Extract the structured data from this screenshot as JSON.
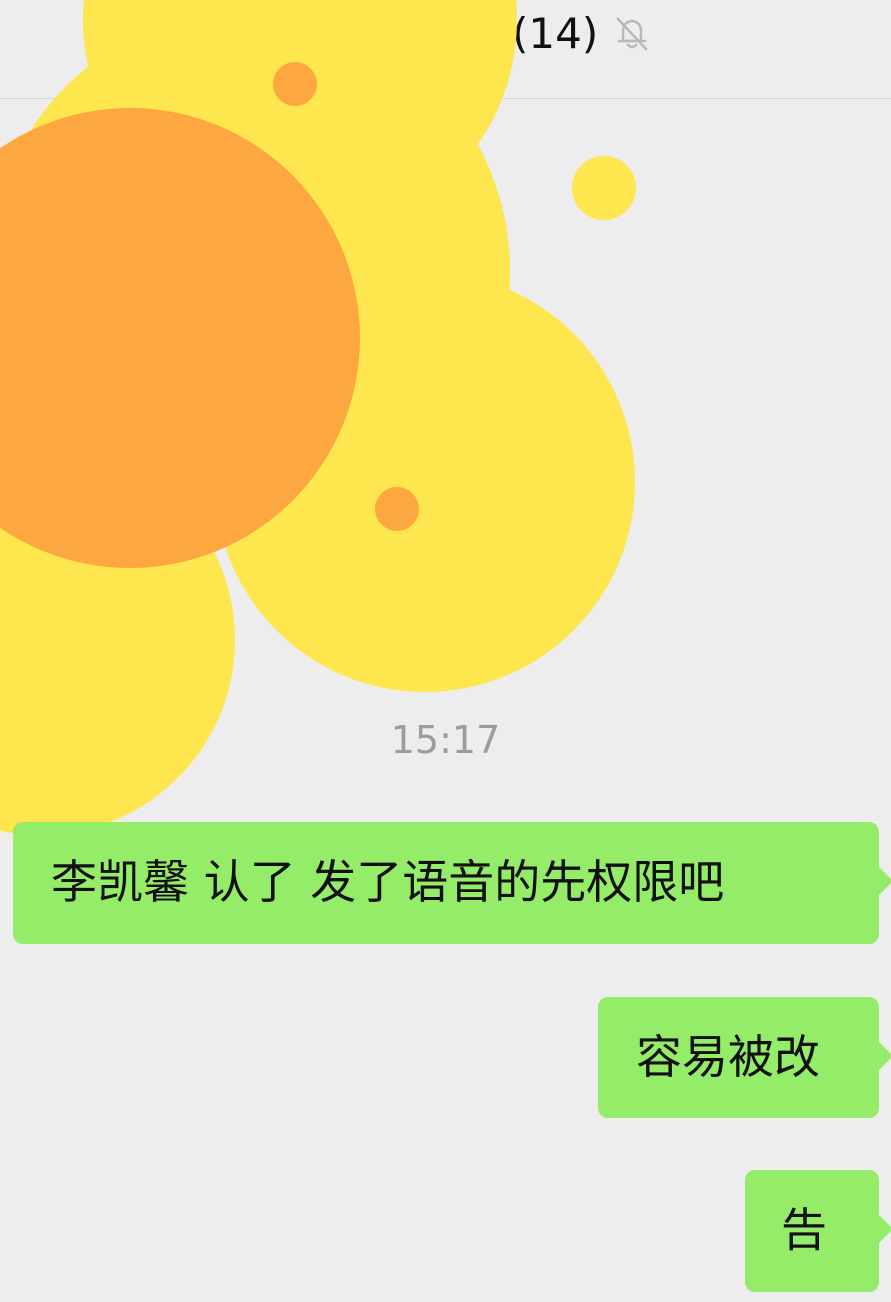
{
  "header": {
    "title": "(14)",
    "mute_icon": "bell-slash-icon"
  },
  "chat": {
    "timestamp": "15:17",
    "messages": [
      {
        "side": "outgoing",
        "text": "李凯馨 认了 发了语音的先权限吧"
      },
      {
        "side": "outgoing",
        "text": "容易被改"
      },
      {
        "side": "outgoing",
        "text": "告"
      }
    ]
  },
  "colors": {
    "background": "#ededed",
    "outgoing_bubble": "#95ec69",
    "sticker_petal": "#fee64f",
    "sticker_center": "#fda740"
  },
  "sticker": {
    "icon": "sunflower-sticker-icon"
  }
}
